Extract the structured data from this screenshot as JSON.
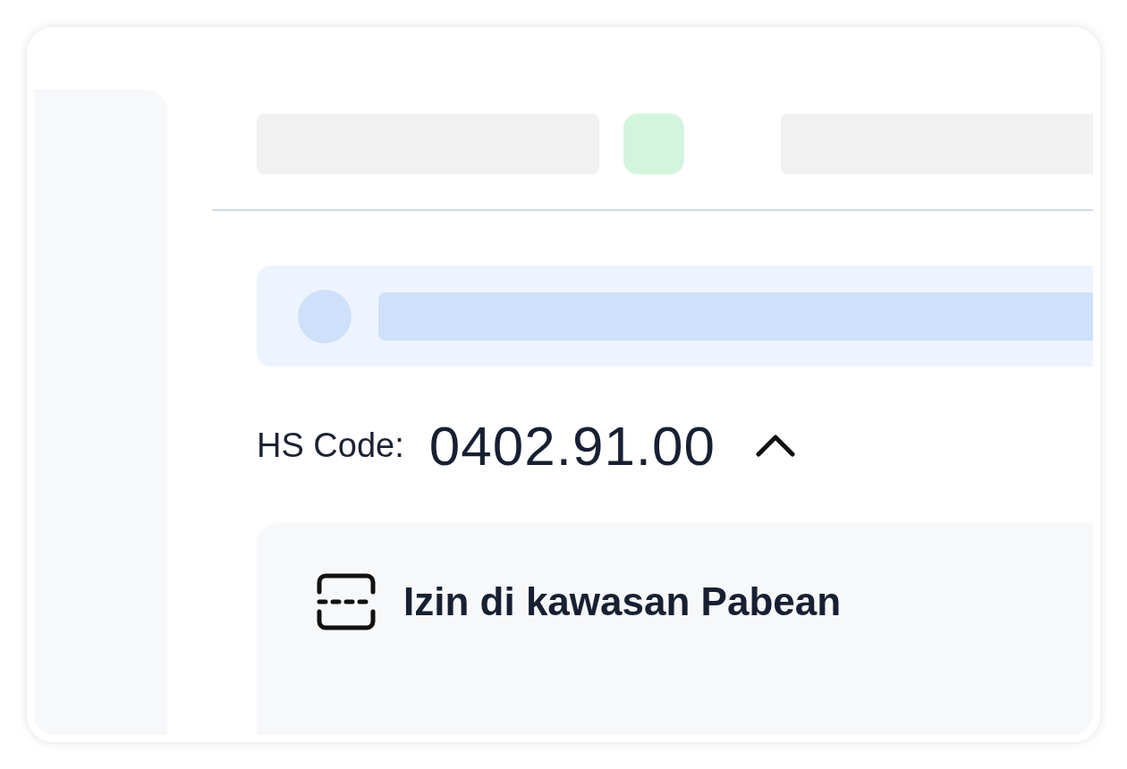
{
  "hs_code": {
    "label": "HS Code:",
    "value": "0402.91.00",
    "expanded": true
  },
  "section": {
    "title": "Izin di kawasan Pabean"
  }
}
